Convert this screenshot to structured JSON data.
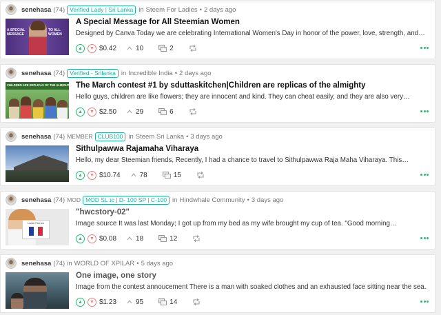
{
  "posts": [
    {
      "author": "senehasa",
      "reputation": "(74)",
      "role": "",
      "badge": "Verified Lady | Sri Lanka",
      "community_prefix": "in",
      "community": "Steem For Ladies",
      "time": "2 days ago",
      "title": "A Special Message for All Steemian Women",
      "summary": "Designed by Canva Today we are celebrating International Women's Day in honor of the power, love, strength, and…",
      "payout": "$0.42",
      "votes": "10",
      "comments": "2",
      "thumb_text_left": "A SPECIAL MESSAGE",
      "thumb_text_right": "TO ALL WOMEN"
    },
    {
      "author": "senehasa",
      "reputation": "(74)",
      "role": "",
      "badge": "Verified - Srilanka",
      "community_prefix": "in",
      "community": "Incredible India",
      "time": "2 days ago",
      "title": "The March contest #1 by sduttaskitchen|Children are replicas of the almighty",
      "summary": "Hello guys, children are like flowers; they are innocent and kind. They can cheat easily, and they are also very…",
      "payout": "$2.50",
      "votes": "29",
      "comments": "6",
      "thumb_text": "CHILDREN ARE REPLICAS OF THE ALMIGHTY"
    },
    {
      "author": "senehasa",
      "reputation": "(74)",
      "role": "MEMBER",
      "badge": "CLUB100",
      "community_prefix": "in",
      "community": "Steem Sri Lanka",
      "time": "3 days ago",
      "title": "Sithulpawwa Rajamaha Viharaya",
      "summary": "Hello, my dear Steemian friends, Recently, I had a chance to travel to Sithulpawwa Raja Maha Viharaya. This…",
      "payout": "$10.74",
      "votes": "78",
      "comments": "15"
    },
    {
      "author": "senehasa",
      "reputation": "(74)",
      "role": "MOD",
      "badge": "MOD SL ɪᴄ | D- 100 SP | C-100",
      "community_prefix": "in",
      "community": "Hindwhale Community",
      "time": "3 days ago",
      "title": "\"hwcstory-02\"",
      "summary": "Image source It was last Monday; I got up from my bed as my wife brought my cup of tea. \"Good morning…",
      "payout": "$0.08",
      "votes": "18",
      "comments": "12",
      "thumb_text": "Learn French"
    },
    {
      "author": "senehasa",
      "reputation": "(74)",
      "role": "",
      "badge": "",
      "community_prefix": "in",
      "community": "WORLD OF XPILAR",
      "time": "5 days ago",
      "title": "One image, one story",
      "summary": "Image from the contest annoucement There is a man with soaked clothes and an exhausted face sitting near the sea.…",
      "payout": "$1.23",
      "votes": "95",
      "comments": "14"
    }
  ],
  "separator": "•",
  "colors": {
    "accent": "#2eb872",
    "downvote": "#e68080",
    "badge": "#1ab2a0"
  },
  "icons": {
    "upvote": "chevron-up-icon",
    "downvote": "chevron-down-icon",
    "votes": "caret-up-icon",
    "comments": "comments-icon",
    "resteem": "resteem-icon",
    "more": "more-dots-icon"
  }
}
